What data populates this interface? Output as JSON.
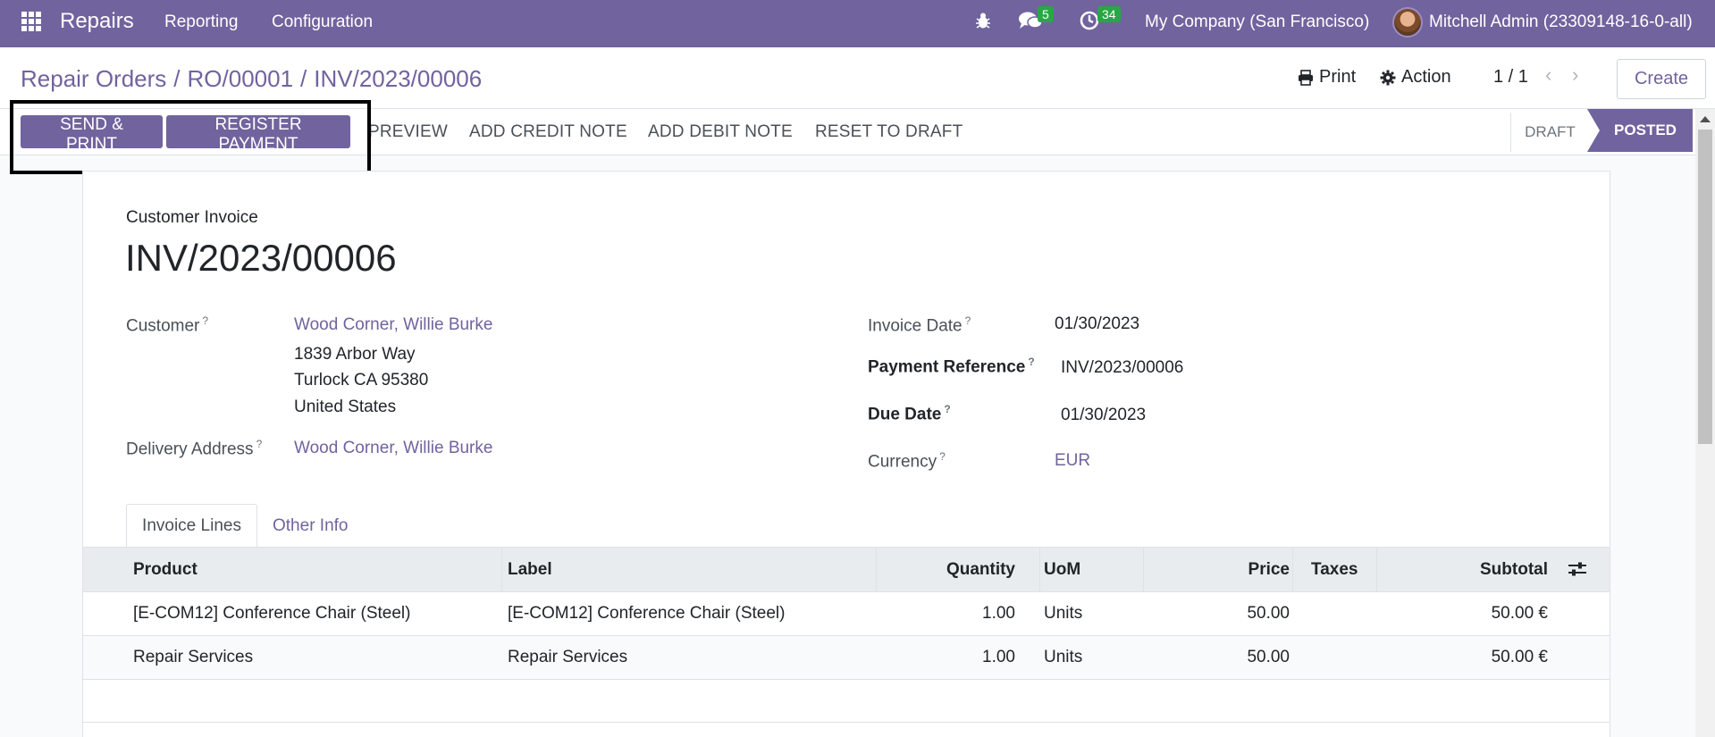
{
  "navbar": {
    "app_name": "Repairs",
    "menus": [
      "Reporting",
      "Configuration"
    ],
    "messages_count": "5",
    "activities_count": "34",
    "company": "My Company (San Francisco)",
    "user": "Mitchell Admin (23309148-16-0-all)"
  },
  "breadcrumb": {
    "items": [
      "Repair Orders",
      "RO/00001"
    ],
    "current": "INV/2023/00006",
    "separator": "/"
  },
  "control_panel": {
    "print_label": "Print",
    "action_label": "Action",
    "pager": "1 / 1",
    "create_label": "Create"
  },
  "statusbar": {
    "buttons": {
      "send_print": "SEND & PRINT",
      "register_payment": "REGISTER PAYMENT",
      "preview": "PREVIEW",
      "add_credit_note": "ADD CREDIT NOTE",
      "add_debit_note": "ADD DEBIT NOTE",
      "reset_to_draft": "RESET TO DRAFT"
    },
    "stages": {
      "draft": "DRAFT",
      "posted": "POSTED"
    }
  },
  "invoice": {
    "doc_type": "Customer Invoice",
    "number": "INV/2023/00006",
    "customer": {
      "label": "Customer",
      "name": "Wood Corner, Willie Burke",
      "address_lines": [
        "1839 Arbor Way",
        "Turlock CA 95380",
        "United States"
      ]
    },
    "delivery_address": {
      "label": "Delivery Address",
      "value": "Wood Corner, Willie Burke"
    },
    "invoice_date": {
      "label": "Invoice Date",
      "value": "01/30/2023"
    },
    "payment_reference": {
      "label": "Payment Reference",
      "value": "INV/2023/00006"
    },
    "due_date": {
      "label": "Due Date",
      "value": "01/30/2023"
    },
    "currency": {
      "label": "Currency",
      "value": "EUR"
    },
    "help_mark": "?"
  },
  "tabs": {
    "invoice_lines": "Invoice Lines",
    "other_info": "Other Info"
  },
  "lines_table": {
    "headers": {
      "product": "Product",
      "label": "Label",
      "quantity": "Quantity",
      "uom": "UoM",
      "price": "Price",
      "taxes": "Taxes",
      "subtotal": "Subtotal"
    },
    "rows": [
      {
        "product": "[E-COM12] Conference Chair (Steel)",
        "label": "[E-COM12] Conference Chair (Steel)",
        "quantity": "1.00",
        "uom": "Units",
        "price": "50.00",
        "taxes": "",
        "subtotal": "50.00 €"
      },
      {
        "product": "Repair Services",
        "label": "Repair Services",
        "quantity": "1.00",
        "uom": "Units",
        "price": "50.00",
        "taxes": "",
        "subtotal": "50.00 €"
      }
    ]
  },
  "colors": {
    "brand": "#71639e",
    "badge": "#28a745",
    "highlight": "#000000"
  },
  "icons": [
    "apps-grid-icon",
    "bug-icon",
    "chat-icon",
    "activity-clock-icon",
    "print-icon",
    "gear-icon",
    "chevron-left-icon",
    "chevron-right-icon",
    "optional-columns-icon"
  ]
}
